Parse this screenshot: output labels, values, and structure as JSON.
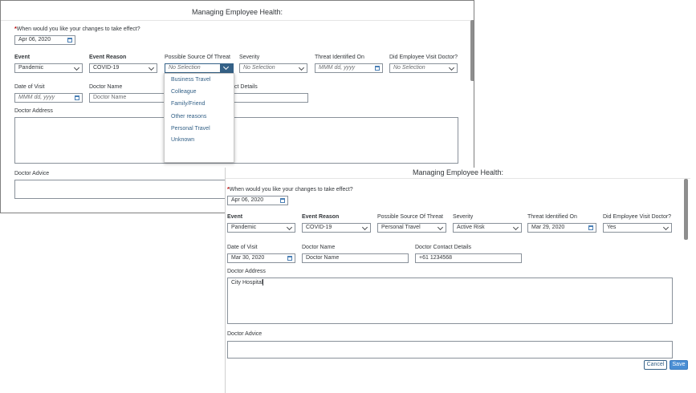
{
  "panel_a": {
    "title": "Managing Employee Health:",
    "effective_prompt_required": "*",
    "effective_prompt": "When would you like your changes to take effect?",
    "effective_date": "Apr 06, 2020",
    "fields": {
      "event": {
        "label": "Event",
        "value": "Pandemic"
      },
      "event_reason": {
        "label": "Event Reason",
        "value": "COVID-19"
      },
      "source": {
        "label": "Possible Source Of Threat",
        "value": "No Selection"
      },
      "severity": {
        "label": "Severity",
        "value": "No Selection"
      },
      "threat_date": {
        "label": "Threat Identified On",
        "value": "MMM dd, yyyy"
      },
      "visit_doctor": {
        "label": "Did Employee Visit Doctor?",
        "value": "No Selection"
      },
      "visit_date": {
        "label": "Date of Visit",
        "value": "MMM dd, yyyy"
      },
      "doctor_name": {
        "label": "Doctor Name",
        "value": "Doctor Name"
      },
      "contact_details": {
        "label": "ct Details",
        "value": ""
      },
      "doctor_address": {
        "label": "Doctor Address",
        "value": ""
      },
      "doctor_advice": {
        "label": "Doctor Advice",
        "value": ""
      }
    },
    "source_options": [
      "Business Travel",
      "Colleague",
      "Family/Friend",
      "Other reasons",
      "Personal Travel",
      "Unknown"
    ]
  },
  "panel_b": {
    "title": "Managing Employee Health:",
    "effective_prompt_required": "*",
    "effective_prompt": "When would you like your changes to take effect?",
    "effective_date": "Apr 06, 2020",
    "fields": {
      "event": {
        "label": "Event",
        "value": "Pandemic"
      },
      "event_reason": {
        "label": "Event Reason",
        "value": "COVID-19"
      },
      "source": {
        "label": "Possible Source Of Threat",
        "value": "Personal Travel"
      },
      "severity": {
        "label": "Severity",
        "value": "Active Risk"
      },
      "threat_date": {
        "label": "Threat Identified On",
        "value": "Mar 29, 2020"
      },
      "visit_doctor": {
        "label": "Did Employee Visit Doctor?",
        "value": "Yes"
      },
      "visit_date": {
        "label": "Date of Visit",
        "value": "Mar 30, 2020"
      },
      "doctor_name": {
        "label": "Doctor Name",
        "value": "Doctor Name"
      },
      "contact_details": {
        "label": "Doctor Contact Details",
        "value": "+61 1234568"
      },
      "doctor_address": {
        "label": "Doctor Address",
        "value": "City Hospital"
      },
      "doctor_advice": {
        "label": "Doctor Advice",
        "value": ""
      }
    },
    "cancel_label": "Cancel",
    "save_label": "Save"
  },
  "icons": {
    "dropdown": "chevron-down-icon",
    "calendar": "calendar-icon"
  },
  "colors": {
    "accent": "#346187",
    "required": "#bb0000",
    "save_button": "#4a8ed4"
  }
}
